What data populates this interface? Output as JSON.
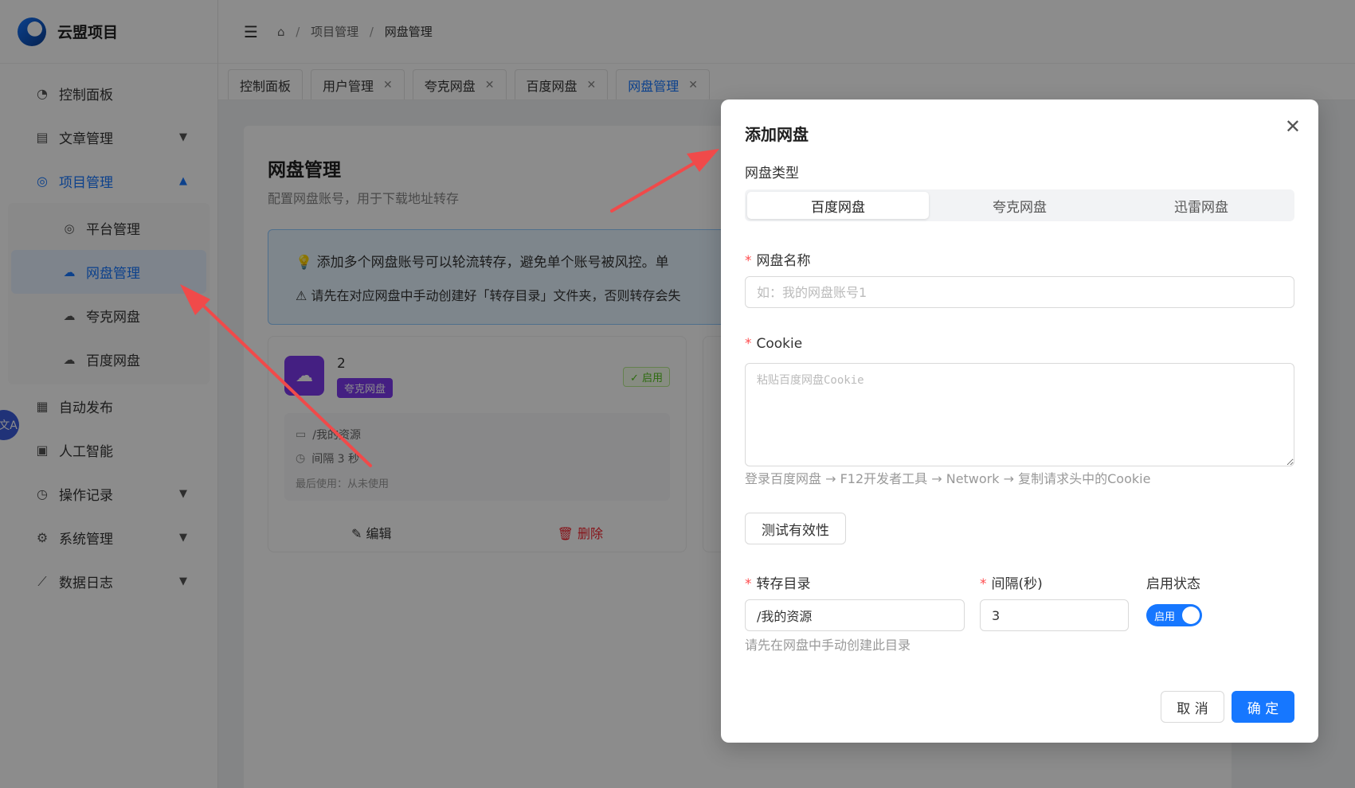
{
  "app": {
    "title": "云盟项目"
  },
  "sidebar": {
    "items": [
      {
        "label": "控制面板",
        "icon": "dashboard-icon"
      },
      {
        "label": "文章管理",
        "icon": "document-icon"
      },
      {
        "label": "项目管理",
        "icon": "project-icon"
      },
      {
        "label": "自动发布",
        "icon": "calendar-icon"
      },
      {
        "label": "人工智能",
        "icon": "ai-icon"
      },
      {
        "label": "操作记录",
        "icon": "clock-icon"
      },
      {
        "label": "系统管理",
        "icon": "gear-icon"
      },
      {
        "label": "数据日志",
        "icon": "chart-line-icon"
      }
    ],
    "submenu": [
      {
        "label": "平台管理"
      },
      {
        "label": "网盘管理"
      },
      {
        "label": "夸克网盘"
      },
      {
        "label": "百度网盘"
      }
    ],
    "translate_badge": "文A"
  },
  "breadcrumb": {
    "level1": "项目管理",
    "level2": "网盘管理",
    "sep": "/"
  },
  "tabs": [
    {
      "label": "控制面板"
    },
    {
      "label": "用户管理"
    },
    {
      "label": "夸克网盘"
    },
    {
      "label": "百度网盘"
    },
    {
      "label": "网盘管理"
    }
  ],
  "page": {
    "title": "网盘管理",
    "subtitle": "配置网盘账号，用于下载地址转存",
    "tip1": "添加多个网盘账号可以轮流转存，避免单个账号被风控。单",
    "tip2": "请先在对应网盘中手动创建好「转存目录」文件夹，否则转存会失"
  },
  "account_card": {
    "name": "2",
    "tag": "夸克网盘",
    "status": "启用",
    "dir": "/我的资源",
    "interval": "间隔 3 秒",
    "last_used": "最后使用：从未使用",
    "edit_label": "编辑",
    "delete_label": "删除"
  },
  "modal": {
    "title": "添加网盘",
    "type_label": "网盘类型",
    "types": [
      "百度网盘",
      "夸克网盘",
      "迅雷网盘"
    ],
    "selected_type": "百度网盘",
    "name_label": "网盘名称",
    "name_placeholder": "如：我的网盘账号1",
    "name_value": "",
    "cookie_label": "Cookie",
    "cookie_placeholder": "粘贴百度网盘Cookie",
    "cookie_hint": "登录百度网盘 → F12开发者工具 → Network → 复制请求头中的Cookie",
    "test_label": "测试有效性",
    "dir_label": "转存目录",
    "dir_value": "/我的资源",
    "dir_hint": "请先在网盘中手动创建此目录",
    "interval_label": "间隔(秒)",
    "interval_value": "3",
    "status_label": "启用状态",
    "status_value": "启用",
    "cancel_label": "取 消",
    "confirm_label": "确 定"
  },
  "colors": {
    "primary": "#1677ff",
    "required": "#ff4d4f",
    "annotation": "#f04a4a"
  }
}
